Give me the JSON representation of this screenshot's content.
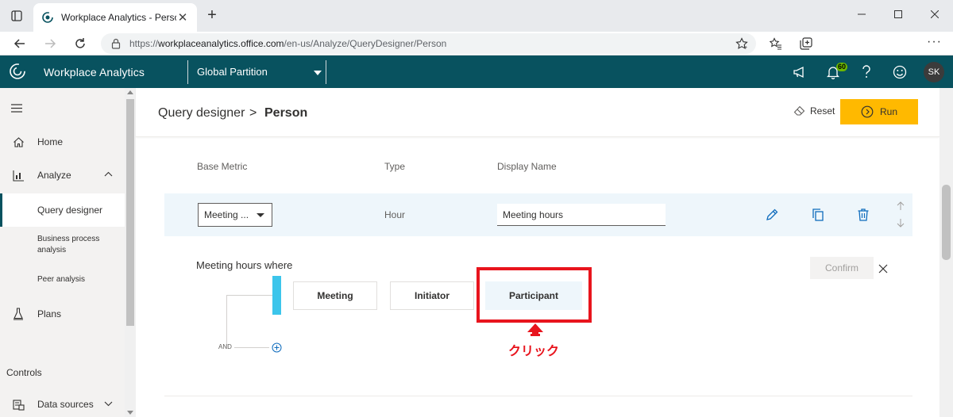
{
  "browser": {
    "tab_title": "Workplace Analytics - Person",
    "url_prefix": "https://",
    "url_host": "workplaceanalytics.office.com",
    "url_path": "/en-us/Analyze/QueryDesigner/Person"
  },
  "app": {
    "name": "Workplace Analytics",
    "partition": "Global Partition",
    "notification_count": "60",
    "user_initials": "SK",
    "accent_color": "#08525f"
  },
  "nav": {
    "home": "Home",
    "analyze": "Analyze",
    "query_designer": "Query designer",
    "business_process": "Business process analysis",
    "peer_analysis": "Peer analysis",
    "plans": "Plans",
    "controls": "Controls",
    "data_sources": "Data sources"
  },
  "main": {
    "breadcrumb_parent": "Query designer",
    "breadcrumb_separator": ">",
    "breadcrumb_current": "Person",
    "reset_label": "Reset",
    "run_label": "Run",
    "columns": {
      "base_metric": "Base Metric",
      "type": "Type",
      "display_name": "Display Name"
    },
    "metric_row": {
      "base_metric_value": "Meeting ...",
      "type_value": "Hour",
      "display_name_value": "Meeting hours"
    },
    "where_label": "Meeting hours where",
    "confirm_label": "Confirm",
    "filters": {
      "meeting": "Meeting",
      "initiator": "Initiator",
      "participant": "Participant"
    },
    "and_label": "AND"
  },
  "annotation": {
    "click_label": "クリック",
    "color": "#e8141d"
  }
}
